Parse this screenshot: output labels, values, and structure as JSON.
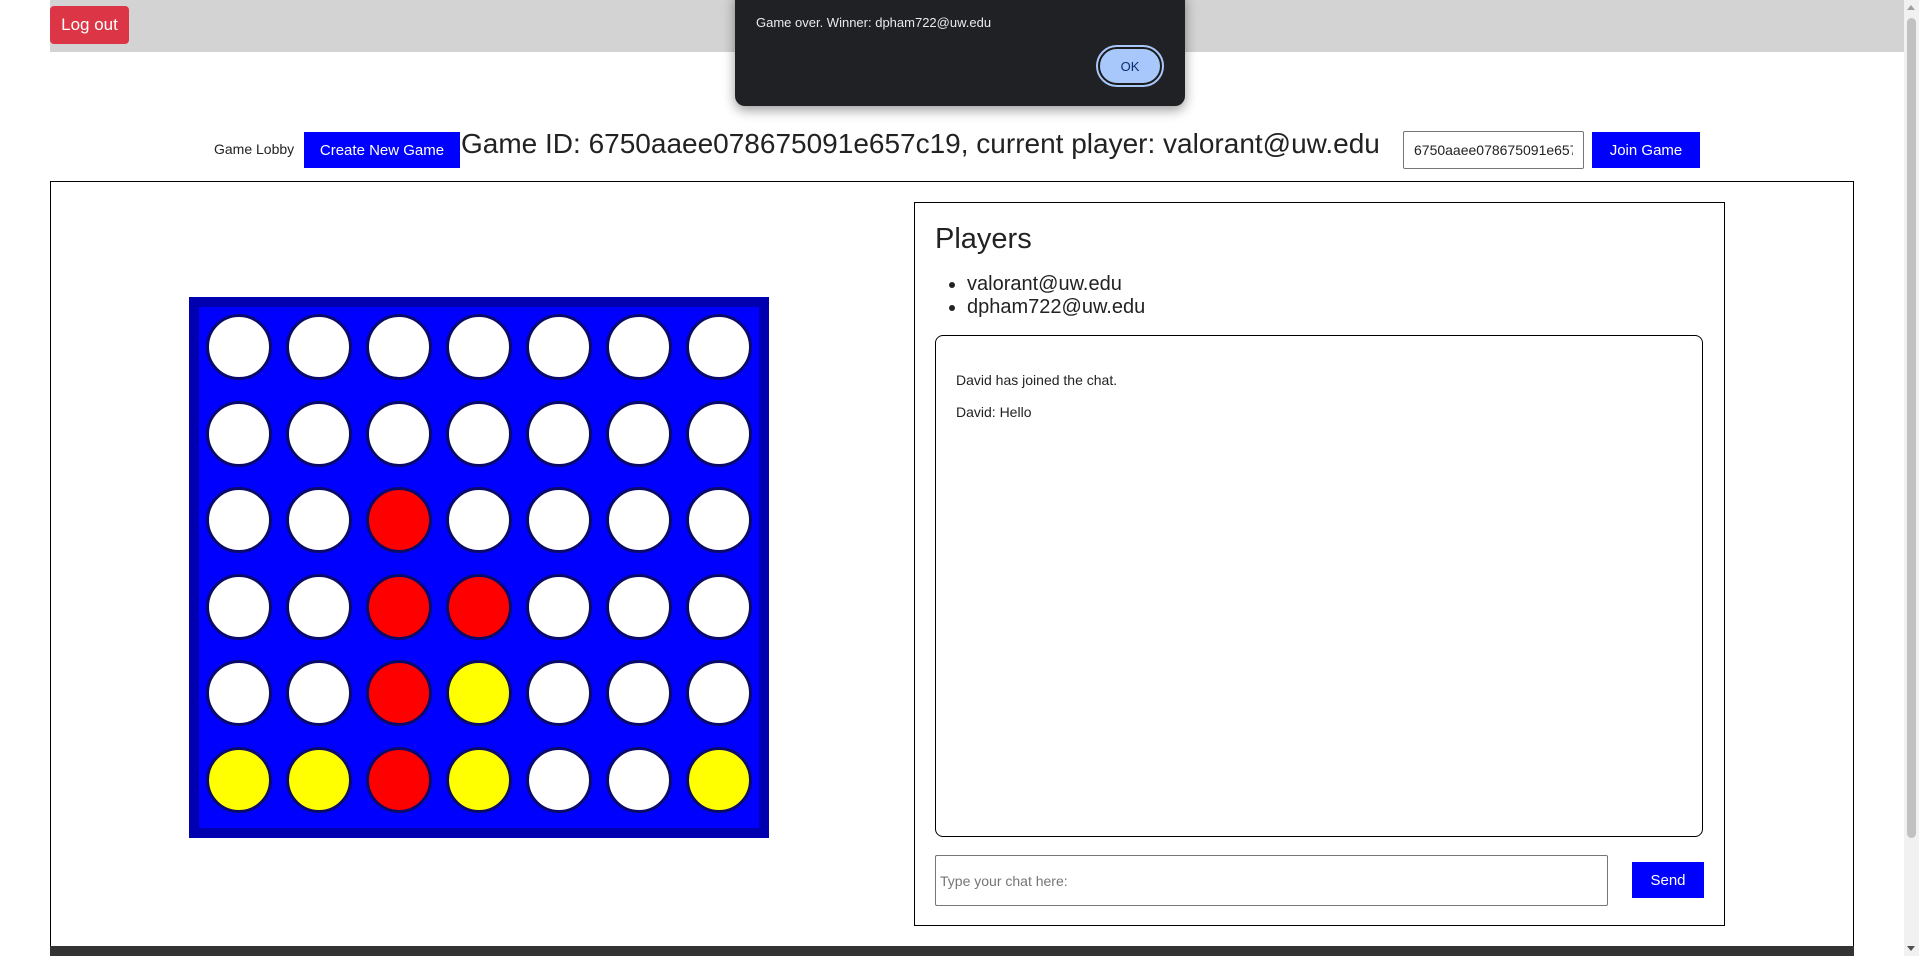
{
  "header": {
    "logout_label": "Log out"
  },
  "lobby": {
    "label": "Game Lobby",
    "create_label": "Create New Game",
    "heading": "Game ID: 6750aaee078675091e657c19, current player: valorant@uw.edu",
    "join_input_value": "6750aaee078675091e657c19",
    "join_label": "Join Game"
  },
  "board": {
    "rows": 6,
    "columns": 7,
    "grid": [
      [
        "empty",
        "empty",
        "empty",
        "empty",
        "empty",
        "empty",
        "empty"
      ],
      [
        "empty",
        "empty",
        "empty",
        "empty",
        "empty",
        "empty",
        "empty"
      ],
      [
        "empty",
        "empty",
        "red",
        "empty",
        "empty",
        "empty",
        "empty"
      ],
      [
        "empty",
        "empty",
        "red",
        "red",
        "empty",
        "empty",
        "empty"
      ],
      [
        "empty",
        "empty",
        "red",
        "yellow",
        "empty",
        "empty",
        "empty"
      ],
      [
        "yellow",
        "yellow",
        "red",
        "yellow",
        "empty",
        "empty",
        "yellow"
      ]
    ],
    "colors": {
      "board": "#0000ff",
      "frame": "#0000b0",
      "empty": "#ffffff",
      "red": "#ff0000",
      "yellow": "#ffff00"
    }
  },
  "players": {
    "title": "Players",
    "list": [
      "valorant@uw.edu",
      "dpham722@uw.edu"
    ]
  },
  "chat": {
    "messages": [
      "David has joined the chat.",
      "David: Hello"
    ],
    "input_placeholder": "Type your chat here:",
    "send_label": "Send"
  },
  "alert": {
    "message": "Game over. Winner: dpham722@uw.edu",
    "ok_label": "OK"
  },
  "colors": {
    "accent": "#0000ff",
    "danger": "#dc3545",
    "topbar": "#d3d3d3",
    "dialog": "#202124"
  }
}
